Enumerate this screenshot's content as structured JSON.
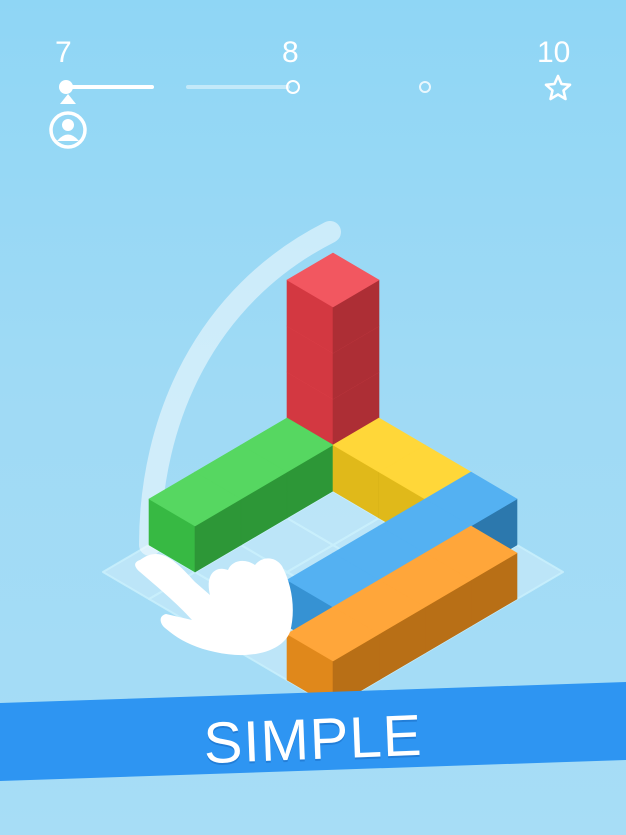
{
  "hud": {
    "current_level": "7",
    "next_level": "8",
    "goal_level": "10",
    "progress_fraction": 0.39
  },
  "icons": {
    "player": "person-icon",
    "goal": "star-icon",
    "gesture": "pointing-hand-icon"
  },
  "colors": {
    "background": "#9fdaf5",
    "green": "#3fd24c",
    "red": "#f0404a",
    "yellow": "#ffd21e",
    "blue": "#3da6f0",
    "orange": "#ff9a1f",
    "banner": "#2e95f2"
  },
  "banner": {
    "label": "SIMPLE"
  }
}
